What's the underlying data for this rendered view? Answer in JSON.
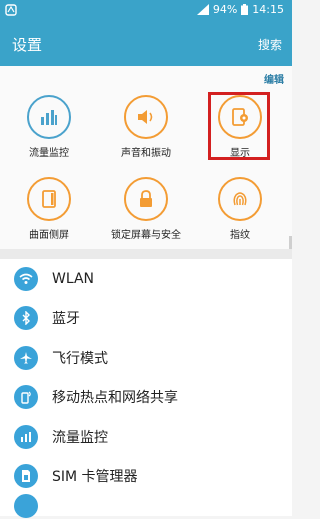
{
  "status_bar": {
    "battery": "94%",
    "time": "14:15"
  },
  "app_bar": {
    "title": "设置",
    "search": "搜索"
  },
  "quick_settings": {
    "edit": "编辑",
    "items": [
      {
        "label": "流量监控",
        "icon": "data-usage-icon",
        "color": "#4aa2cc"
      },
      {
        "label": "声音和振动",
        "icon": "sound-icon",
        "color": "#f39c34"
      },
      {
        "label": "显示",
        "icon": "display-icon",
        "color": "#f39c34"
      },
      {
        "label": "曲面侧屏",
        "icon": "edge-screen-icon",
        "color": "#f39c34"
      },
      {
        "label": "锁定屏幕与安全",
        "icon": "lock-icon",
        "color": "#f39c34"
      },
      {
        "label": "指纹",
        "icon": "fingerprint-icon",
        "color": "#f39c34"
      }
    ]
  },
  "list": {
    "items": [
      {
        "label": "WLAN",
        "icon": "wifi-icon"
      },
      {
        "label": "蓝牙",
        "icon": "bluetooth-icon"
      },
      {
        "label": "飞行模式",
        "icon": "airplane-icon"
      },
      {
        "label": "移动热点和网络共享",
        "icon": "hotspot-icon"
      },
      {
        "label": "流量监控",
        "icon": "data-usage-icon"
      },
      {
        "label": "SIM 卡管理器",
        "icon": "sim-icon"
      }
    ]
  },
  "colors": {
    "accent": "#3aa3c9",
    "orange": "#f39c34",
    "highlight": "#d32020"
  }
}
